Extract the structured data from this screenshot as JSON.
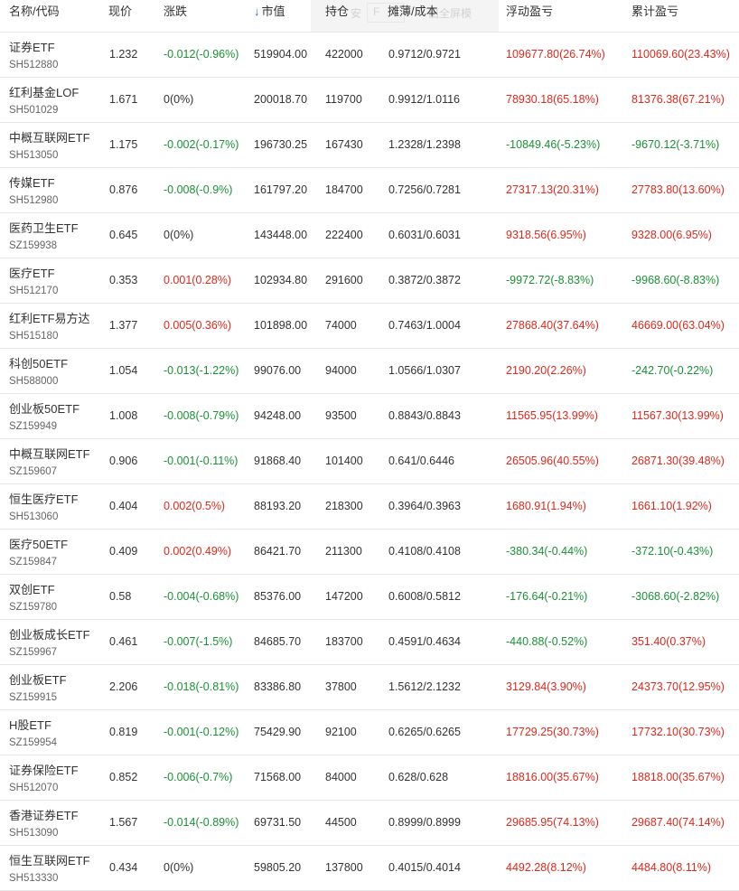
{
  "header": {
    "name_code": "名称/代码",
    "price": "现价",
    "change": "涨跌",
    "market_value": "市值",
    "position": "持仓",
    "cost": "摊薄/成本",
    "float_pnl": "浮动盈亏",
    "total_pnl": "累计盈亏",
    "sort_indicator": "↓",
    "fullscreen_hint_left": "安",
    "fullscreen_hint_key": "F",
    "fullscreen_hint_right": "出全屏模"
  },
  "colors": {
    "up": "#e0281c",
    "down": "#1a9135",
    "sort": "#1e6fd0"
  },
  "rows": [
    {
      "name": "证券ETF",
      "code": "SH512880",
      "price": "1.232",
      "change": "-0.012(-0.96%)",
      "change_dir": "down",
      "mv": "519904.00",
      "pos": "422000",
      "cost": "0.9712/0.9721",
      "float": "109677.80(26.74%)",
      "float_dir": "up",
      "total": "110069.60(23.43%)",
      "total_dir": "up"
    },
    {
      "name": "红利基金LOF",
      "code": "SH501029",
      "price": "1.671",
      "change": "0(0%)",
      "change_dir": "flat",
      "mv": "200018.70",
      "pos": "119700",
      "cost": "0.9912/1.0116",
      "float": "78930.18(65.18%)",
      "float_dir": "up",
      "total": "81376.38(67.21%)",
      "total_dir": "up"
    },
    {
      "name": "中概互联网ETF",
      "code": "SH513050",
      "price": "1.175",
      "change": "-0.002(-0.17%)",
      "change_dir": "down",
      "mv": "196730.25",
      "pos": "167430",
      "cost": "1.2328/1.2398",
      "float": "-10849.46(-5.23%)",
      "float_dir": "down",
      "total": "-9670.12(-3.71%)",
      "total_dir": "down"
    },
    {
      "name": "传媒ETF",
      "code": "SH512980",
      "price": "0.876",
      "change": "-0.008(-0.9%)",
      "change_dir": "down",
      "mv": "161797.20",
      "pos": "184700",
      "cost": "0.7256/0.7281",
      "float": "27317.13(20.31%)",
      "float_dir": "up",
      "total": "27783.80(13.60%)",
      "total_dir": "up"
    },
    {
      "name": "医药卫生ETF",
      "code": "SZ159938",
      "price": "0.645",
      "change": "0(0%)",
      "change_dir": "flat",
      "mv": "143448.00",
      "pos": "222400",
      "cost": "0.6031/0.6031",
      "float": "9318.56(6.95%)",
      "float_dir": "up",
      "total": "9328.00(6.95%)",
      "total_dir": "up"
    },
    {
      "name": "医疗ETF",
      "code": "SH512170",
      "price": "0.353",
      "change": "0.001(0.28%)",
      "change_dir": "up",
      "mv": "102934.80",
      "pos": "291600",
      "cost": "0.3872/0.3872",
      "float": "-9972.72(-8.83%)",
      "float_dir": "down",
      "total": "-9968.60(-8.83%)",
      "total_dir": "down"
    },
    {
      "name": "红利ETF易方达",
      "code": "SH515180",
      "price": "1.377",
      "change": "0.005(0.36%)",
      "change_dir": "up",
      "mv": "101898.00",
      "pos": "74000",
      "cost": "0.7463/1.0004",
      "float": "27868.40(37.64%)",
      "float_dir": "up",
      "total": "46669.00(63.04%)",
      "total_dir": "up"
    },
    {
      "name": "科创50ETF",
      "code": "SH588000",
      "price": "1.054",
      "change": "-0.013(-1.22%)",
      "change_dir": "down",
      "mv": "99076.00",
      "pos": "94000",
      "cost": "1.0566/1.0307",
      "float": "2190.20(2.26%)",
      "float_dir": "up",
      "total": "-242.70(-0.22%)",
      "total_dir": "down"
    },
    {
      "name": "创业板50ETF",
      "code": "SZ159949",
      "price": "1.008",
      "change": "-0.008(-0.79%)",
      "change_dir": "down",
      "mv": "94248.00",
      "pos": "93500",
      "cost": "0.8843/0.8843",
      "float": "11565.95(13.99%)",
      "float_dir": "up",
      "total": "11567.30(13.99%)",
      "total_dir": "up"
    },
    {
      "name": "中概互联网ETF",
      "code": "SZ159607",
      "price": "0.906",
      "change": "-0.001(-0.11%)",
      "change_dir": "down",
      "mv": "91868.40",
      "pos": "101400",
      "cost": "0.641/0.6446",
      "float": "26505.96(40.55%)",
      "float_dir": "up",
      "total": "26871.30(39.48%)",
      "total_dir": "up"
    },
    {
      "name": "恒生医疗ETF",
      "code": "SH513060",
      "price": "0.404",
      "change": "0.002(0.5%)",
      "change_dir": "up",
      "mv": "88193.20",
      "pos": "218300",
      "cost": "0.3964/0.3963",
      "float": "1680.91(1.94%)",
      "float_dir": "up",
      "total": "1661.10(1.92%)",
      "total_dir": "up"
    },
    {
      "name": "医疗50ETF",
      "code": "SZ159847",
      "price": "0.409",
      "change": "0.002(0.49%)",
      "change_dir": "up",
      "mv": "86421.70",
      "pos": "211300",
      "cost": "0.4108/0.4108",
      "float": "-380.34(-0.44%)",
      "float_dir": "down",
      "total": "-372.10(-0.43%)",
      "total_dir": "down"
    },
    {
      "name": "双创ETF",
      "code": "SZ159780",
      "price": "0.58",
      "change": "-0.004(-0.68%)",
      "change_dir": "down",
      "mv": "85376.00",
      "pos": "147200",
      "cost": "0.6008/0.5812",
      "float": "-176.64(-0.21%)",
      "float_dir": "down",
      "total": "-3068.60(-2.82%)",
      "total_dir": "down"
    },
    {
      "name": "创业板成长ETF",
      "code": "SZ159967",
      "price": "0.461",
      "change": "-0.007(-1.5%)",
      "change_dir": "down",
      "mv": "84685.70",
      "pos": "183700",
      "cost": "0.4591/0.4634",
      "float": "-440.88(-0.52%)",
      "float_dir": "down",
      "total": "351.40(0.37%)",
      "total_dir": "up"
    },
    {
      "name": "创业板ETF",
      "code": "SZ159915",
      "price": "2.206",
      "change": "-0.018(-0.81%)",
      "change_dir": "down",
      "mv": "83386.80",
      "pos": "37800",
      "cost": "1.5612/2.1232",
      "float": "3129.84(3.90%)",
      "float_dir": "up",
      "total": "24373.70(12.95%)",
      "total_dir": "up"
    },
    {
      "name": "H股ETF",
      "code": "SZ159954",
      "price": "0.819",
      "change": "-0.001(-0.12%)",
      "change_dir": "down",
      "mv": "75429.90",
      "pos": "92100",
      "cost": "0.6265/0.6265",
      "float": "17729.25(30.73%)",
      "float_dir": "up",
      "total": "17732.10(30.73%)",
      "total_dir": "up"
    },
    {
      "name": "证券保险ETF",
      "code": "SH512070",
      "price": "0.852",
      "change": "-0.006(-0.7%)",
      "change_dir": "down",
      "mv": "71568.00",
      "pos": "84000",
      "cost": "0.628/0.628",
      "float": "18816.00(35.67%)",
      "float_dir": "up",
      "total": "18818.00(35.67%)",
      "total_dir": "up"
    },
    {
      "name": "香港证券ETF",
      "code": "SH513090",
      "price": "1.567",
      "change": "-0.014(-0.89%)",
      "change_dir": "down",
      "mv": "69731.50",
      "pos": "44500",
      "cost": "0.8999/0.8999",
      "float": "29685.95(74.13%)",
      "float_dir": "up",
      "total": "29687.40(74.14%)",
      "total_dir": "up"
    },
    {
      "name": "恒生互联网ETF",
      "code": "SH513330",
      "price": "0.434",
      "change": "0(0%)",
      "change_dir": "flat",
      "mv": "59805.20",
      "pos": "137800",
      "cost": "0.4015/0.4014",
      "float": "4492.28(8.12%)",
      "float_dir": "up",
      "total": "4484.80(8.11%)",
      "total_dir": "up"
    }
  ]
}
